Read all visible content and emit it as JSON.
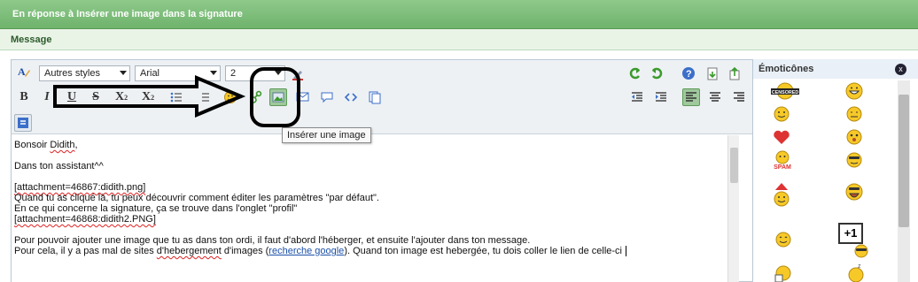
{
  "header": {
    "title": "En réponse à Insérer une image dans la signature"
  },
  "section": {
    "label": "Message"
  },
  "toolbar": {
    "style_select": "Autres styles",
    "font_select": "Arial",
    "size_select": "2",
    "bold": "B",
    "italic": "I",
    "underline": "U",
    "strike": "S",
    "subscript": "X",
    "subscript_mark": "2",
    "superscript": "X",
    "superscript_mark": "2"
  },
  "tooltip": {
    "text": "Insérer une image"
  },
  "editor": {
    "lines": [
      "Bonsoir Didith,",
      "",
      "Dans ton assistant^^",
      "",
      "[attachment=46867:didith.png]",
      "Quand tu as cliqué là, tu peux découvrir comment éditer les paramètres \"par défaut\".",
      "En ce qui concerne la signature, ça se trouve dans l'onglet \"profil\"",
      "[attachment=46868:didith2.PNG]",
      "",
      "Pour pouvoir ajouter une image que tu as dans ton ordi, il faut d'abord l'héberger, et ensuite l'ajouter dans ton message."
    ],
    "last_line_start": "Pour cela, il y a pas mal de sites ",
    "last_line_spell": "d'hebergement",
    "last_line_mid": " d'images (",
    "last_line_link": "recherche google",
    "last_line_end": "). Quand ton image est hebergée, tu dois coller le lien de celle-ci "
  },
  "emoticons": {
    "title": "Émoticônes",
    "close": "x",
    "censored_label": "CENSORED",
    "spam_label": "SPAM",
    "plus_one": "+1"
  },
  "colors": {
    "header_green": "#6fb36c",
    "section_bg": "#e9f4e7",
    "toolbar_bg": "#eef1f4",
    "active_button": "#9fc89c",
    "annotation_black": "#000000"
  }
}
